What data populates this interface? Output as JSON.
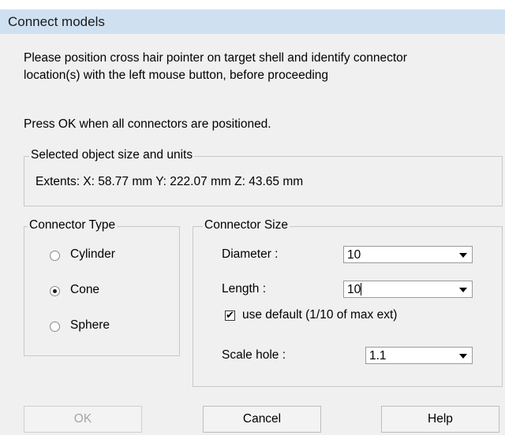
{
  "window": {
    "title": "Connect models"
  },
  "instructions": {
    "line1": "Please position cross hair pointer on target shell and identify connector",
    "line2": "location(s) with the left mouse button, before proceeding",
    "press_ok": "Press OK when all connectors are positioned."
  },
  "object_size": {
    "legend": "Selected object size and units",
    "extents": "Extents:  X: 58.77 mm  Y: 222.07 mm  Z: 43.65 mm"
  },
  "connector_type": {
    "legend": "Connector Type",
    "options": [
      "Cylinder",
      "Cone",
      "Sphere"
    ],
    "selected": "Cone"
  },
  "connector_size": {
    "legend": "Connector Size",
    "diameter_label": "Diameter :",
    "diameter_value": "10",
    "length_label": "Length :",
    "length_value": "10",
    "use_default_label": "use default (1/10 of max ext)",
    "use_default_checked": true,
    "scale_hole_label": "Scale hole :",
    "scale_hole_value": "1.1"
  },
  "buttons": {
    "ok": "OK",
    "cancel": "Cancel",
    "help": "Help"
  }
}
